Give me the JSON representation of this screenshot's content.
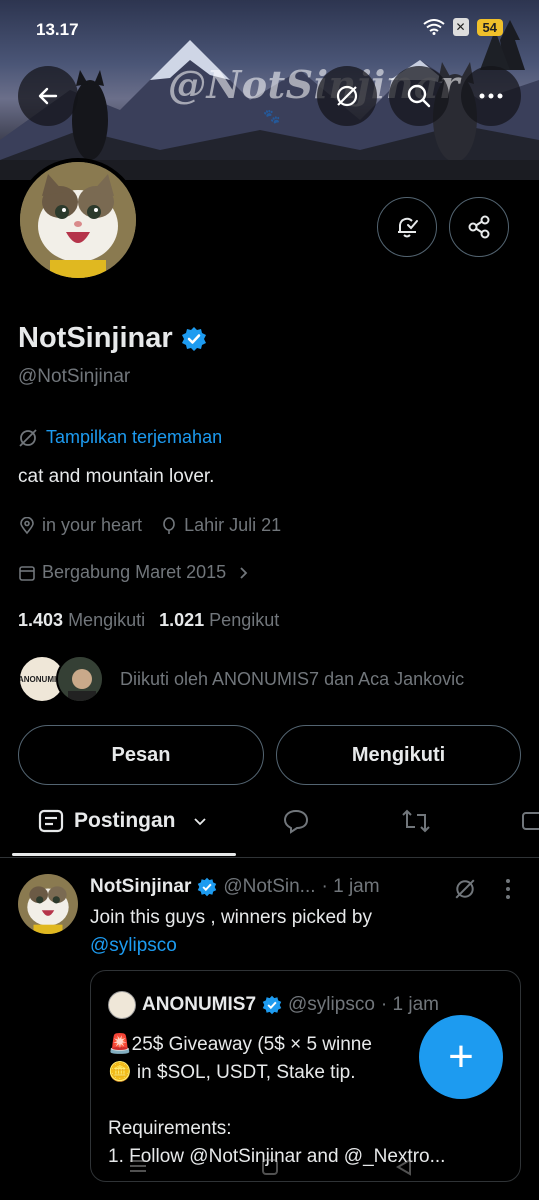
{
  "status_bar": {
    "time": "13.17",
    "battery": "54",
    "notif_badge": "✕"
  },
  "banner": {
    "handle_watermark": "@NotSinjinar",
    "paw": "🐾"
  },
  "profile": {
    "name": "NotSinjinar",
    "handle": "@NotSinjinar",
    "translate_label": "Tampilkan terjemahan",
    "bio": "cat and mountain lover.",
    "location": "in your heart",
    "birthday": "Lahir Juli 21",
    "joined": "Bergabung Maret 2015",
    "following_count": "1.403",
    "following_label": "Mengikuti",
    "followers_count": "1.021",
    "followers_label": "Pengikut",
    "followed_by": "Diikuti oleh ANONUMIS7 dan Aca Jankovic",
    "mini_avatar_text": "ANONUMIS7"
  },
  "buttons": {
    "message": "Pesan",
    "following": "Mengikuti"
  },
  "tabs": {
    "posts": "Postingan"
  },
  "post": {
    "name": "NotSinjinar",
    "handle": "@NotSin...",
    "time": "· 1 jam",
    "text": "Join this guys , winners picked by",
    "mention": "@sylipsco",
    "quote": {
      "name": "ANONUMIS7",
      "handle": "@sylipsco",
      "time": "· 1 jam",
      "body": "🚨25$ Giveaway (5$ × 5 winne\n🪙 in $SOL, USDT, Stake tip.\n\nRequirements:\n1. Follow @NotSinjinar and @_Nextro..."
    }
  },
  "fab": {
    "label": "+"
  },
  "colors": {
    "accent": "#1d9bf0",
    "background": "#000000",
    "text": "#e7e9ea",
    "muted": "#71767b",
    "border": "#536471"
  }
}
